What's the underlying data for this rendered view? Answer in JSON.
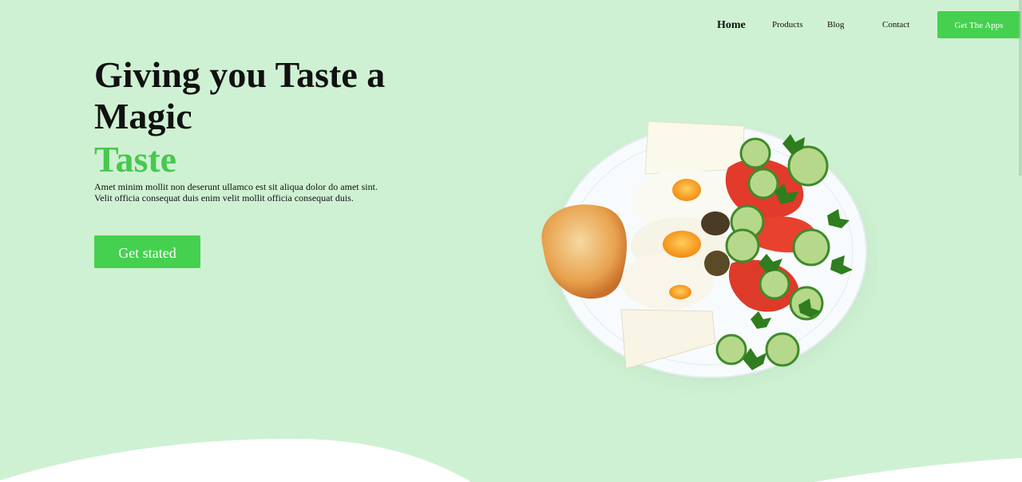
{
  "nav": {
    "home": "Home",
    "products": "Products",
    "blog": "Blog",
    "contact": "Contact",
    "apps_button": "Get The Apps"
  },
  "hero": {
    "title": "Giving you Taste a Magic",
    "accent": "Taste",
    "description": "Amet minim mollit non deserunt ullamco est sit aliqua dolor do amet sint. Velit officia consequat duis enim velit mollit officia consequat duis.",
    "cta_label": "Get stated"
  },
  "colors": {
    "background": "#cff1d3",
    "accent_green": "#45d14f",
    "text_dark": "#111111",
    "wave": "#ffffff"
  },
  "images": {
    "hero_dish": "plate-of-fried-eggs-bread-cheese-and-salad"
  }
}
